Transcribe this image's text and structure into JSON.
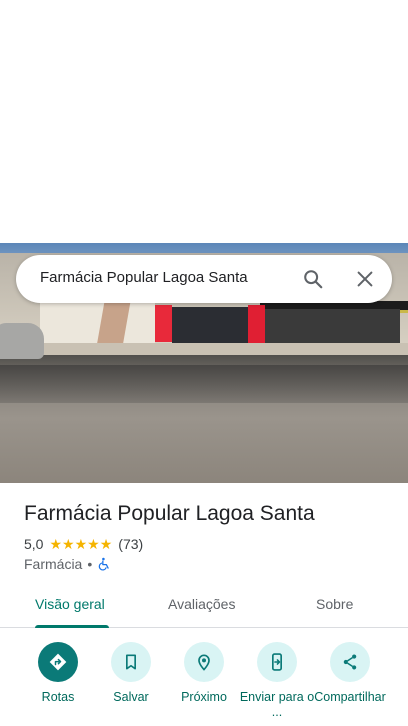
{
  "search": {
    "query": "Farmácia Popular Lagoa Santa"
  },
  "place": {
    "title": "Farmácia Popular Lagoa Santa",
    "rating": "5,0",
    "stars": 5,
    "review_count": "(73)",
    "category": "Farmácia",
    "separator": "•"
  },
  "tabs": [
    {
      "label": "Visão geral",
      "active": true
    },
    {
      "label": "Avaliações",
      "active": false
    },
    {
      "label": "Sobre",
      "active": false
    }
  ],
  "actions": [
    {
      "label": "Rotas",
      "icon": "directions-icon"
    },
    {
      "label": "Salvar",
      "icon": "bookmark-icon"
    },
    {
      "label": "Próximo",
      "icon": "nearby-icon"
    },
    {
      "label": "Enviar para o ...",
      "icon": "send-to-phone-icon"
    },
    {
      "label": "Compartilhar",
      "icon": "share-icon"
    }
  ],
  "colors": {
    "accent": "#00796b",
    "action_circle": "#d9f4f4",
    "action_circle_primary": "#0b7a78",
    "star": "#f5b400"
  }
}
